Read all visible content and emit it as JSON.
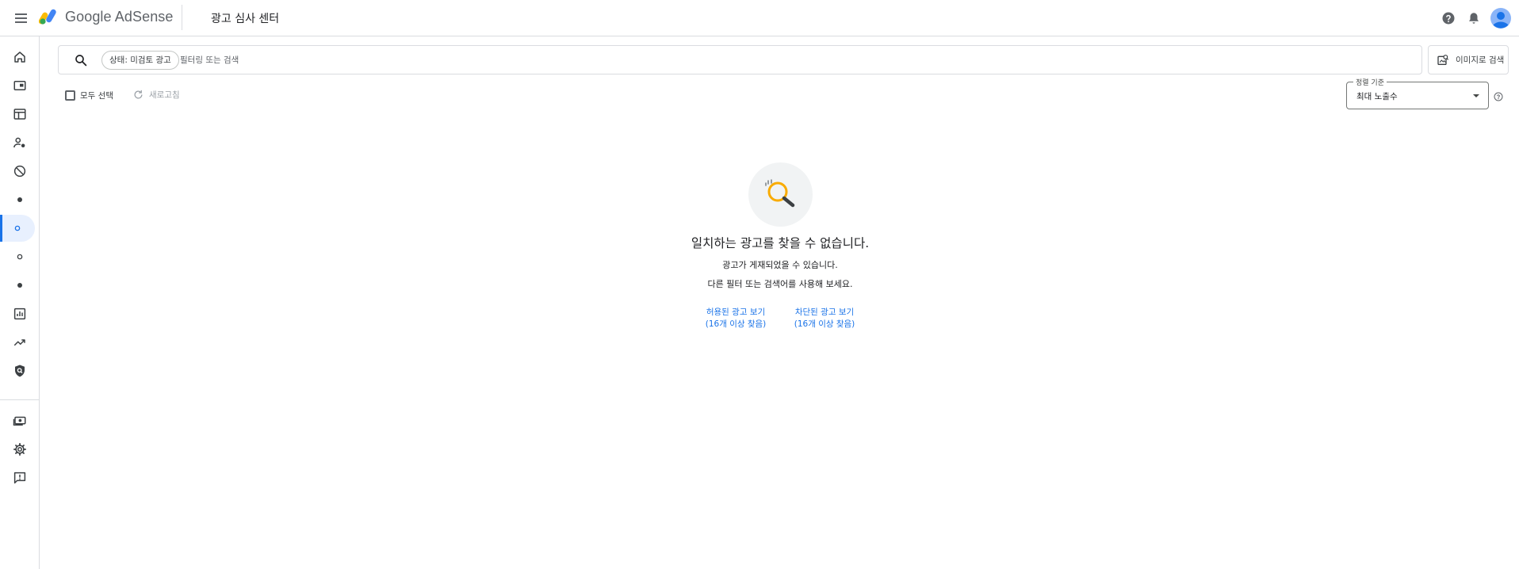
{
  "header": {
    "brand_google": "Google",
    "brand_product": "AdSense",
    "page_title": "광고 심사 센터"
  },
  "search": {
    "filter_chip": "상태: 미검토 광고",
    "placeholder": "필터링 또는 검색",
    "image_search_label": "이미지로 검색"
  },
  "toolbar": {
    "select_all_label": "모두 선택",
    "refresh_label": "새로고침",
    "sort_legend": "정렬 기준",
    "sort_value": "최대 노출수"
  },
  "empty_state": {
    "title": "일치하는 광고를 찾을 수 없습니다.",
    "line1": "광고가 게재되었을 수 있습니다.",
    "line2": "다른 필터 또는 검색어를 사용해 보세요.",
    "allowed_link_line1": "허용된 광고 보기",
    "allowed_link_line2": "(16개 이상 찾음)",
    "blocked_link_line1": "차단된 광고 보기",
    "blocked_link_line2": "(16개 이상 찾음)"
  },
  "sidebar": {
    "items": [
      {
        "icon": "home-icon"
      },
      {
        "icon": "ads-icon"
      },
      {
        "icon": "sites-icon"
      },
      {
        "icon": "privacy-messaging-icon"
      },
      {
        "icon": "block-icon"
      },
      {
        "icon": "dot-filled-icon"
      },
      {
        "icon": "dot-outline-icon",
        "active": true
      },
      {
        "icon": "dot-outline-icon"
      },
      {
        "icon": "dot-filled-icon"
      },
      {
        "icon": "reports-icon"
      },
      {
        "icon": "optimization-icon"
      },
      {
        "icon": "policy-center-icon"
      },
      {
        "icon": "payments-icon"
      },
      {
        "icon": "settings-icon"
      },
      {
        "icon": "feedback-icon"
      }
    ]
  },
  "colors": {
    "accent": "#1a73e8",
    "active_bg": "#e8f0fe",
    "border": "#dadce0"
  }
}
